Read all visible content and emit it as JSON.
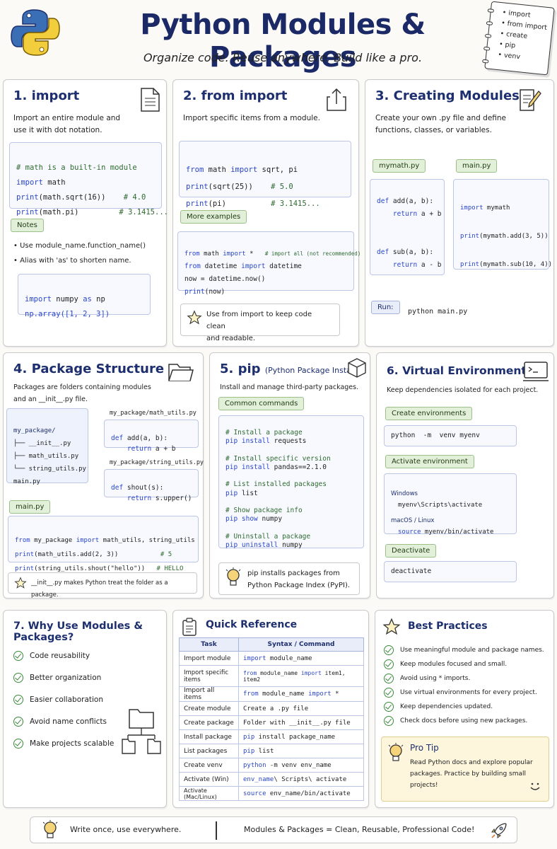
{
  "header": {
    "title": "Python Modules & Packages",
    "subtitle": "Organize code. Reuse anywhere. Build like a pro.",
    "notebook_items": [
      "import",
      "from import",
      "create",
      "pip",
      "venv"
    ]
  },
  "panel1": {
    "title": "1. import",
    "desc1": "Import an entire module and",
    "desc2": "use it with dot notation.",
    "code": [
      {
        "c": "# math is a built-in module"
      },
      {
        "k": "import",
        "t": " math"
      },
      {
        "p": "print",
        "t": "(math.sqrt(16))",
        "c": "# 4.0"
      },
      {
        "p": "print",
        "t": "(math.pi)",
        "c": "# 3.1415..."
      }
    ],
    "notes_tag": "Notes",
    "notes": [
      "Use module_name.function_name()",
      "Alias with 'as' to shorten name."
    ],
    "alias_code": [
      {
        "k": "import",
        "t": " numpy ",
        "k2": "as",
        "t2": " np"
      },
      {
        "t": "np.array([1, 2, 3])"
      }
    ]
  },
  "panel2": {
    "title": "2. from import",
    "desc": "Import specific items from a module.",
    "code": [
      {
        "k": "from",
        "t": " math ",
        "k2": "import",
        "t2": " sqrt, pi"
      },
      {
        "p": "print",
        "t": "(sqrt(25))",
        "c": "# 5.0"
      },
      {
        "p": "print",
        "t": "(pi)",
        "c": "# 3.1415..."
      }
    ],
    "more_tag": "More examples",
    "more_code": [
      {
        "k": "from",
        "t": " math ",
        "k2": "import",
        "t2": " *",
        "c": "# import all (not recommended)"
      },
      {
        "k": "from",
        "t": " datetime ",
        "k2": "import",
        "t2": " datetime"
      },
      {
        "t": "now = datetime.now()"
      },
      {
        "p": "print",
        "t": "(now)"
      }
    ],
    "tip1": "Use from import to keep code clean",
    "tip2": "and readable."
  },
  "panel3": {
    "title": "3. Creating Modules",
    "desc1": "Create your own .py file and define",
    "desc2": "functions, classes, or variables.",
    "file1_tag": "mymath.py",
    "file1_code": [
      {
        "k": "def",
        "t": " add(a, b):"
      },
      {
        "k": "    return",
        "t": " a + b"
      },
      {
        "t": ""
      },
      {
        "t": ""
      },
      {
        "k": "def",
        "t": " sub(a, b):"
      },
      {
        "k": "    return",
        "t": " a - b"
      }
    ],
    "file2_tag": "main.py",
    "file2_code": [
      {
        "k": "import",
        "t": " mymath"
      },
      {
        "t": ""
      },
      {
        "p": "print",
        "t": "(mymath.add(3, 5))"
      },
      {
        "t": ""
      },
      {
        "p": "print",
        "t": "(mymath.sub(10, 4))"
      }
    ],
    "run_tag": "Run:",
    "run_cmd": "python main.py"
  },
  "panel4": {
    "title": "4. Package Structure",
    "desc1": "Packages are folders containing modules",
    "desc2": "and an __init__.py file.",
    "tree": [
      "my_package/",
      "├── __init__.py",
      "├── math_utils.py",
      "└── string_utils.py",
      "main.py"
    ],
    "file1_label": "my_package/math_utils.py",
    "file1_code": [
      {
        "k": "def",
        "t": " add(a, b):"
      },
      {
        "k": "    return",
        "t": " a + b"
      }
    ],
    "file2_label": "my_package/string_utils.py",
    "file2_code": [
      {
        "k": "def",
        "t": " shout(s):"
      },
      {
        "k": "    return",
        "t": " s.upper()"
      }
    ],
    "main_tag": "main.py",
    "main_code": [
      {
        "k": "from",
        "t": " my_package ",
        "k2": "import",
        "t2": " math_utils, string_utils"
      },
      {
        "p": "print",
        "t": "(math_utils.add(2, 3))",
        "c": "# 5"
      },
      {
        "p": "print",
        "t": "(string_utils.shout(\"hello\"))",
        "c": "# HELLO"
      }
    ],
    "note": "__init__.py makes Python treat the folder as a package."
  },
  "panel5": {
    "title": "5. pip",
    "title_small": "(Python Package Installer)",
    "desc": "Install and manage third-party packages.",
    "tag": "Common commands",
    "code": [
      {
        "c": "# Install a package"
      },
      {
        "k": "pip install",
        "t": " requests"
      },
      {
        "t": ""
      },
      {
        "c": "# Install specific version"
      },
      {
        "k": "pip install",
        "t": " pandas==2.1.0"
      },
      {
        "t": ""
      },
      {
        "c": "# List installed packages"
      },
      {
        "k": "pip",
        "t": " list"
      },
      {
        "t": ""
      },
      {
        "c": "# Show package info"
      },
      {
        "k": "pip show",
        "t": " numpy"
      },
      {
        "t": ""
      },
      {
        "c": "# Uninstall a package"
      },
      {
        "k": "pip uninstall",
        "t": " numpy"
      }
    ],
    "note1": "pip installs packages from",
    "note2": "Python Package Index (PyPI)."
  },
  "panel6": {
    "title": "6. Virtual Environments",
    "desc": "Keep dependencies isolated for each project.",
    "create_tag": "Create environments",
    "create_cmd": "python  -m  venv myenv",
    "activate_tag": "Activate environment",
    "win_label": "Windows",
    "win_cmd": "myenv\\Scripts\\activate",
    "mac_label": "macOS / Linux",
    "mac_kw": "source",
    "mac_cmd": " myenv/bin/activate",
    "deactivate_tag": "Deactivate",
    "deactivate_cmd": "deactivate"
  },
  "panel7": {
    "title": "7. Why Use Modules & Packages?",
    "items": [
      "Code reusability",
      "Better organization",
      "Easier collaboration",
      "Avoid name conflicts",
      "Make projects scalable"
    ]
  },
  "quickref": {
    "title": "Quick Reference",
    "headers": [
      "Task",
      "Syntax / Command"
    ],
    "rows": [
      {
        "task": "Import module",
        "kw": "import",
        "rest": " module_name"
      },
      {
        "task": "Import specific items",
        "kw": "from",
        "rest": " module_name ",
        "kw2": "import",
        "rest2": " item1, item2"
      },
      {
        "task": "Import all items",
        "kw": "from",
        "rest": " module_name ",
        "kw2": "import",
        "rest2": " *"
      },
      {
        "task": "Create module",
        "kw": "",
        "rest": "Create a .py file"
      },
      {
        "task": "Create package",
        "kw": "",
        "rest": "Folder with __init__.py file"
      },
      {
        "task": "Install package",
        "kw": "pip",
        "rest": " install package_name"
      },
      {
        "task": "List packages",
        "kw": "pip",
        "rest": " list"
      },
      {
        "task": "Create venv",
        "kw": "python",
        "rest": " -m venv env_name"
      },
      {
        "task": "Activate (Win)",
        "kw": "env_name",
        "rest": "\\ Scripts\\ activate"
      },
      {
        "task": "Activate (Mac/Linux)",
        "kw": "source",
        "rest": " env_name/bin/activate"
      }
    ]
  },
  "best": {
    "title": "Best Practices",
    "items": [
      "Use meaningful module and package names.",
      "Keep modules focused and small.",
      "Avoid using * imports.",
      "Use virtual environments for every project.",
      "Keep dependencies updated.",
      "Check docs before using new packages."
    ],
    "tip_title": "Pro Tip",
    "tip_lines": [
      "Read Python docs and explore popular",
      "packages. Practice by building small",
      "projects!"
    ]
  },
  "footer": {
    "left": "Write once, use everywhere.",
    "right": "Modules & Packages = Clean, Reusable, Professional Code!"
  },
  "colors": {
    "navy": "#1d2f6f",
    "keyword": "#2a46c8",
    "comment": "#2f6a2f",
    "tag_green": "#e3f0d9",
    "tip_yellow": "#fdf6dd"
  }
}
